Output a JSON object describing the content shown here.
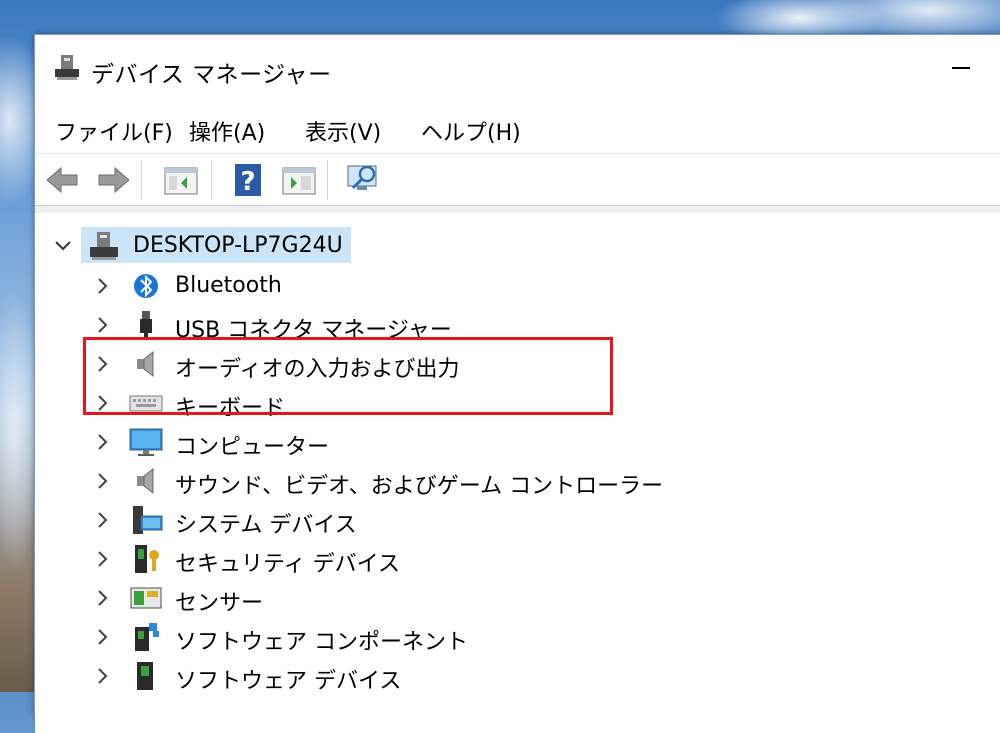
{
  "window": {
    "title": "デバイス マネージャー"
  },
  "menu": [
    {
      "label": "ファイル(F)"
    },
    {
      "label": "操作(A)"
    },
    {
      "label": "表示(V)"
    },
    {
      "label": "ヘルプ(H)"
    }
  ],
  "toolbar": {
    "buttons": [
      {
        "icon": "back-arrow-icon"
      },
      {
        "icon": "forward-arrow-icon"
      },
      {
        "icon": "show-hide-console-tree-icon"
      },
      {
        "icon": "help-icon"
      },
      {
        "icon": "properties-icon"
      },
      {
        "icon": "scan-hardware-icon"
      }
    ]
  },
  "tree": {
    "root": {
      "label": "DESKTOP-LP7G24U",
      "expanded": true,
      "icon": "computer-tower-icon"
    },
    "items": [
      {
        "label": "Bluetooth",
        "icon": "bluetooth-icon"
      },
      {
        "label": "USB コネクタ マネージャー",
        "icon": "usb-plug-icon"
      },
      {
        "label": "オーディオの入力および出力",
        "icon": "speaker-icon"
      },
      {
        "label": "キーボード",
        "icon": "keyboard-icon"
      },
      {
        "label": "コンピューター",
        "icon": "monitor-icon"
      },
      {
        "label": "サウンド、ビデオ、およびゲーム コントローラー",
        "icon": "speaker-icon"
      },
      {
        "label": "システム デバイス",
        "icon": "system-devices-icon"
      },
      {
        "label": "セキュリティ デバイス",
        "icon": "security-key-icon"
      },
      {
        "label": "センサー",
        "icon": "sensor-icon"
      },
      {
        "label": "ソフトウェア コンポーネント",
        "icon": "software-component-icon"
      },
      {
        "label": "ソフトウェア デバイス",
        "icon": "software-device-icon"
      }
    ]
  },
  "annotation": {
    "color": "#e8141c"
  }
}
